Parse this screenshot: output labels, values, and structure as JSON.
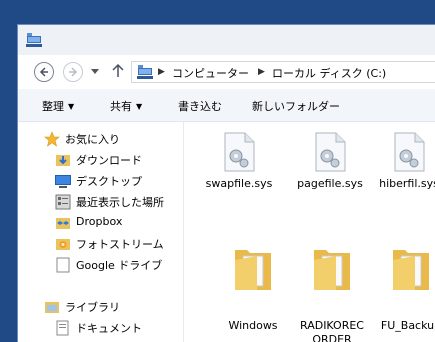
{
  "address": {
    "crumbs": [
      "コンピューター",
      "ローカル ディスク (C:)"
    ]
  },
  "toolbar": {
    "organize": "整理",
    "share": "共有",
    "burn": "書き込む",
    "new_folder": "新しいフォルダー"
  },
  "nav": {
    "favorites_header": "お気に入り",
    "favorites": [
      {
        "label": "ダウンロード",
        "icon": "download-folder-icon"
      },
      {
        "label": "デスクトップ",
        "icon": "desktop-icon"
      },
      {
        "label": "最近表示した場所",
        "icon": "recent-places-icon"
      },
      {
        "label": "Dropbox",
        "icon": "dropbox-icon"
      },
      {
        "label": "フォトストリーム",
        "icon": "photostream-icon"
      },
      {
        "label": "Google ドライブ",
        "icon": "google-drive-icon"
      }
    ],
    "libraries_header": "ライブラリ",
    "libraries": [
      {
        "label": "ドキュメント",
        "icon": "documents-icon"
      }
    ]
  },
  "files": [
    {
      "name": "swapfile.sys",
      "type": "system-file"
    },
    {
      "name": "pagefile.sys",
      "type": "system-file"
    },
    {
      "name": "hiberfil.sys",
      "type": "system-file"
    },
    {
      "name": "Windows",
      "type": "folder"
    },
    {
      "name": "RADIKORECORDER",
      "type": "folder"
    },
    {
      "name": "FU_Backup",
      "type": "folder"
    }
  ],
  "colors": {
    "desktop": "#1f4a86",
    "folder": "#f3cf6b",
    "toolbar_bg": "#f2f6fb"
  }
}
